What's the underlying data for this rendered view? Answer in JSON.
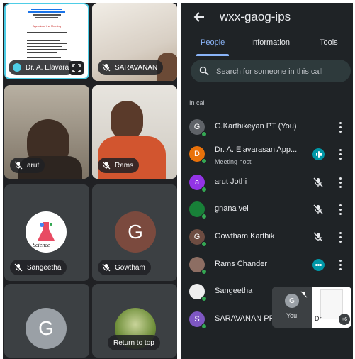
{
  "grid": {
    "tiles": [
      {
        "name": "Dr. A. Elavara",
        "muted": false
      },
      {
        "name": "SARAVANAN",
        "muted": true
      },
      {
        "name": "arut",
        "muted": true
      },
      {
        "name": "Rams",
        "muted": true
      },
      {
        "name": "Sangeetha",
        "muted": true,
        "logo_text": "Science"
      },
      {
        "name": "Gowtham",
        "muted": true,
        "initial": "G"
      },
      {
        "name": "",
        "initial": "G"
      },
      {
        "name": ""
      }
    ],
    "return_to_top": "Return to top",
    "slide_title": "Agenda of the Meeting"
  },
  "panel": {
    "title": "wxx-gaog-ips",
    "tabs": [
      "People",
      "Information",
      "Tools"
    ],
    "search_placeholder": "Search for someone in this call",
    "section_label": "In call",
    "participants": [
      {
        "initial": "G",
        "name": "G.Karthikeyan PT (You)",
        "subtitle": "",
        "status": "none",
        "color": "#5f6368"
      },
      {
        "initial": "D",
        "name": "Dr. A. Elavarasan App...",
        "subtitle": "Meeting host",
        "status": "speaking",
        "color": "#e8710a"
      },
      {
        "initial": "a",
        "name": "arut Jothi",
        "subtitle": "",
        "status": "muted",
        "color": "#9334e6"
      },
      {
        "initial": "",
        "name": "gnana vel",
        "subtitle": "",
        "status": "muted",
        "color": "#188038"
      },
      {
        "initial": "G",
        "name": "Gowtham Karthik",
        "subtitle": "",
        "status": "muted",
        "color": "#6d4c41"
      },
      {
        "initial": "",
        "name": "Rams Chander",
        "subtitle": "",
        "status": "active",
        "color": "#8d6e63"
      },
      {
        "initial": "",
        "name": "Sangeetha",
        "subtitle": "",
        "status": "muted",
        "color": "#eeeeee"
      },
      {
        "initial": "S",
        "name": "SARAVANAN PR",
        "subtitle": "",
        "status": "muted",
        "color": "#7e57c2"
      }
    ],
    "floating": {
      "self_initial": "G",
      "self_label": "You",
      "other_label": "Dr",
      "extra_count": "+6"
    }
  },
  "colors": {
    "accent": "#8ab4f8",
    "speaking": "#0097a7"
  }
}
